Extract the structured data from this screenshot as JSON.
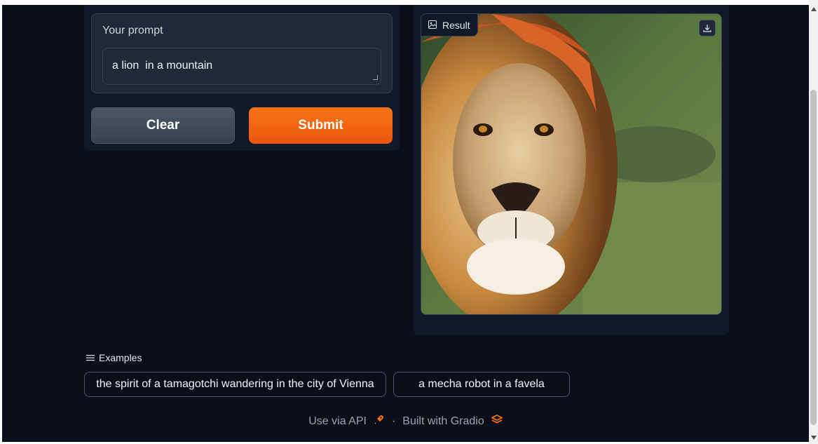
{
  "prompt": {
    "label": "Your prompt",
    "value": "a lion  in a mountain"
  },
  "buttons": {
    "clear_label": "Clear",
    "submit_label": "Submit"
  },
  "result": {
    "label": "Result",
    "image_subject": "lion portrait"
  },
  "examples": {
    "header": "Examples",
    "items": [
      "the spirit of a tamagotchi wandering in the city of Vienna",
      "a mecha robot in a favela"
    ]
  },
  "footer": {
    "api_label": "Use via API",
    "separator": "·",
    "built_label": "Built with Gradio"
  },
  "colors": {
    "background": "#0b0f19",
    "panel": "#111827",
    "accent": "#f97316"
  }
}
